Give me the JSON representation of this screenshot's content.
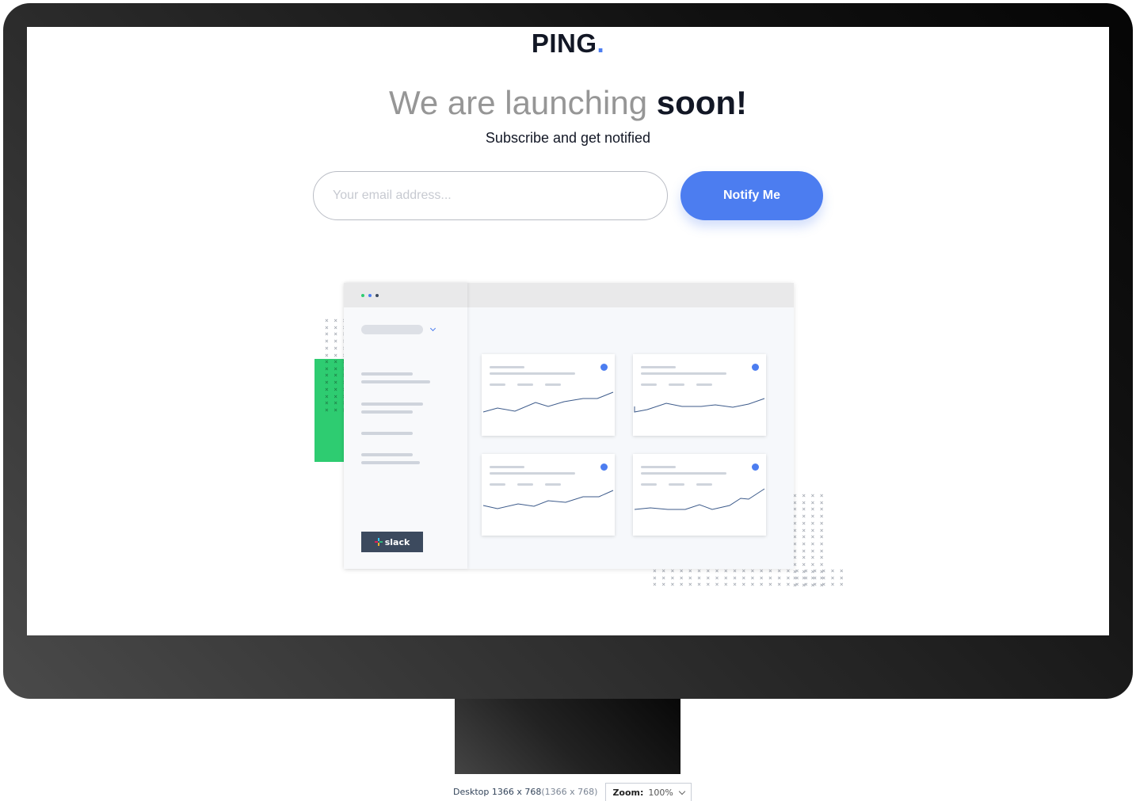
{
  "logo": {
    "text": "PING",
    "dot": "."
  },
  "headline": {
    "light": "We are launching ",
    "bold": "soon!"
  },
  "subheadline": "Subscribe and get notified",
  "form": {
    "email_placeholder": "Your email address...",
    "email_value": "",
    "button_label": "Notify Me"
  },
  "illustration": {
    "badge_label": "slack"
  },
  "preview_bar": {
    "device": "Desktop 1366 x 768",
    "device_dim": "(1366 x 768)",
    "zoom_label": "Zoom:",
    "zoom_value": "100%"
  },
  "colors": {
    "accent": "#4c7df0",
    "green": "#2ecc71",
    "text_dark": "#121725",
    "text_gray": "#969696"
  }
}
